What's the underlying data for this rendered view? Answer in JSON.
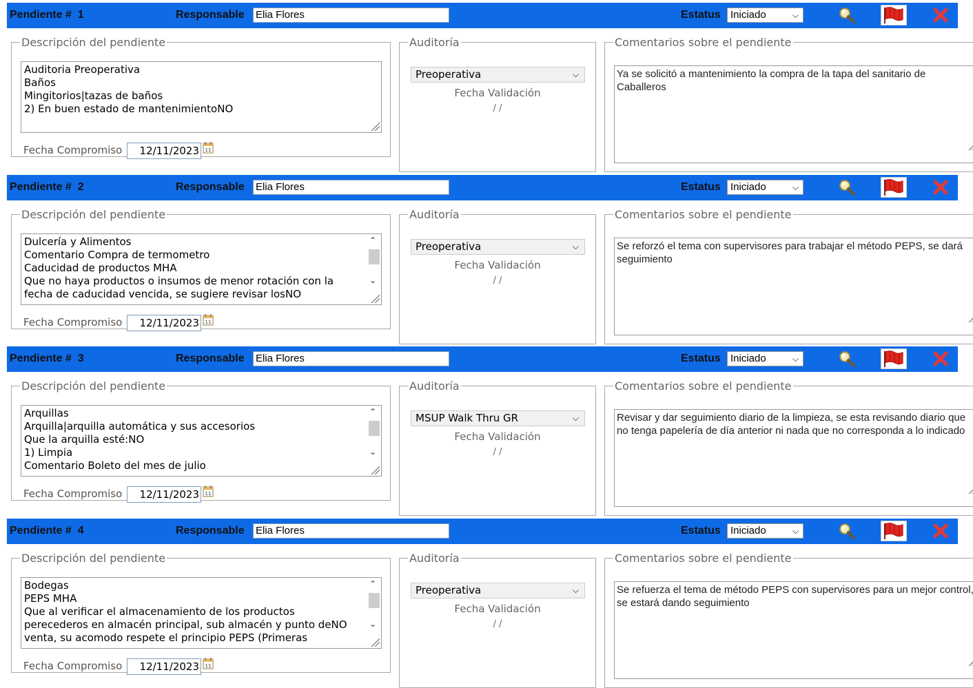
{
  "labels": {
    "pendiente_prefix": "Pendiente #",
    "responsable": "Responsable",
    "estatus": "Estatus",
    "descripcion_legend": "Descripción del pendiente",
    "auditoria_legend": "Auditoría",
    "comentarios_legend": "Comentarios sobre el pendiente",
    "fecha_compromiso": "Fecha Compromiso",
    "fecha_validacion": "Fecha Validación"
  },
  "icons": {
    "search": "search-icon",
    "flag": "flag-icon",
    "close": "close-icon",
    "calendar": "calendar-icon"
  },
  "colors": {
    "header_bar": "#0f6ae6",
    "flag_red": "#e0261d",
    "close_red": "#e03a3a"
  },
  "pendientes": [
    {
      "number": "1",
      "responsable": "Elia Flores",
      "estatus": "Iniciado",
      "descripcion_lines": [
        "Auditoria Preoperativa",
        "Baños",
        "Mingitorios|tazas de baños",
        "2) En buen estado de mantenimientoNO"
      ],
      "has_scrollbar": false,
      "fecha_compromiso": "12/11/2023",
      "auditoria": "Preoperativa",
      "fecha_validacion": "/ /",
      "comentario": "Ya se solicitó a mantenimiento la compra de la tapa del sanitario de Caballeros"
    },
    {
      "number": "2",
      "responsable": "Elia Flores",
      "estatus": "Iniciado",
      "descripcion_lines": [
        "Dulcería y Alimentos",
        "Comentario Compra de termometro",
        "Caducidad de productos MHA",
        "Que no haya productos o insumos de menor rotación con la",
        "fecha de caducidad vencida, se sugiere revisar losNO"
      ],
      "has_scrollbar": true,
      "fecha_compromiso": "12/11/2023",
      "auditoria": "Preoperativa",
      "fecha_validacion": "/ /",
      "comentario": "Se reforzó el tema con supervisores para trabajar el método PEPS, se dará seguimiento"
    },
    {
      "number": "3",
      "responsable": "Elia Flores",
      "estatus": "Iniciado",
      "descripcion_lines": [
        "Arquillas",
        "Arquilla|arquilla automática y sus accesorios",
        "Que la arquilla esté:NO",
        "1) Limpia",
        "Comentario Boleto del mes de julio"
      ],
      "has_scrollbar": true,
      "fecha_compromiso": "12/11/2023",
      "auditoria": "MSUP Walk Thru GR",
      "fecha_validacion": "/ /",
      "comentario": "Revisar y dar seguimiento diario de la limpieza, se esta revisando diario que no tenga papelería de día anterior ni nada que no corresponda a lo indicado"
    },
    {
      "number": "4",
      "responsable": "Elia Flores",
      "estatus": "Iniciado",
      "descripcion_lines": [
        "Bodegas",
        "PEPS MHA",
        "Que al verificar el almacenamiento de los productos",
        "perecederos en almacén principal, sub almacén y punto deNO",
        "venta, su acomodo respete el principio PEPS (Primeras"
      ],
      "has_scrollbar": true,
      "fecha_compromiso": "12/11/2023",
      "auditoria": "Preoperativa",
      "fecha_validacion": "/ /",
      "comentario": "Se refuerza el tema de método PEPS con supervisores para un mejor control, se estará dando seguimiento"
    }
  ]
}
